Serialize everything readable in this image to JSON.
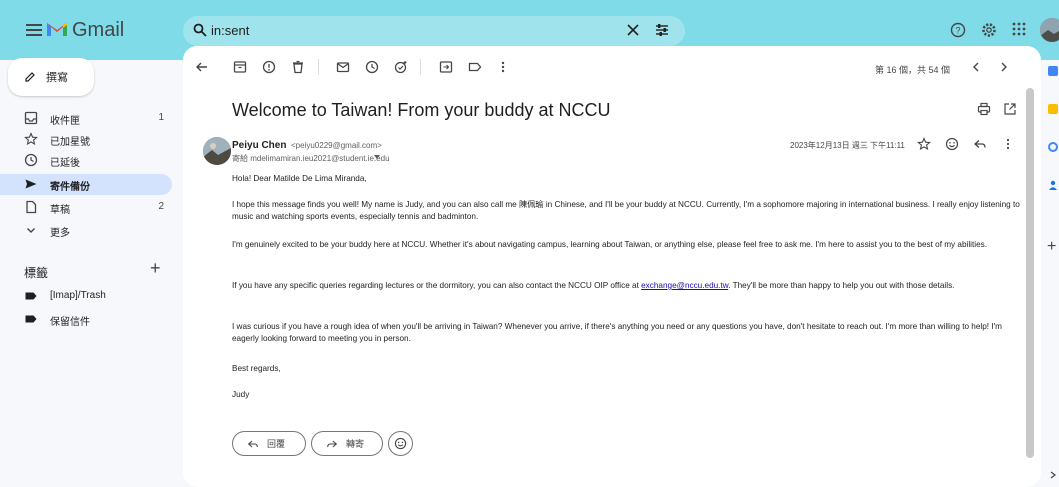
{
  "app": {
    "name": "Gmail",
    "brand_colors": {
      "topbar": "#7fdbe7",
      "active_nav": "#d3e3fd",
      "link": "#1a0dab"
    }
  },
  "search": {
    "value": "in:sent"
  },
  "sidebar": {
    "compose_label": "撰寫",
    "items": [
      {
        "label": "收件匣",
        "count": "1",
        "icon": "inbox-icon"
      },
      {
        "label": "已加星號",
        "count": "",
        "icon": "star-icon"
      },
      {
        "label": "已延後",
        "count": "",
        "icon": "clock-icon"
      },
      {
        "label": "寄件備份",
        "count": "",
        "icon": "send-icon",
        "active": true
      },
      {
        "label": "草稿",
        "count": "2",
        "icon": "draft-icon"
      },
      {
        "label": "更多",
        "count": "",
        "icon": "chevron-down-icon"
      }
    ],
    "labels_heading": "標籤",
    "labels": [
      {
        "label": "[Imap]/Trash",
        "icon": "label-icon"
      },
      {
        "label": "保留信件",
        "icon": "label-icon"
      }
    ]
  },
  "toolbar": {
    "page_info": "第 16 個，共 54 個"
  },
  "email": {
    "subject": "Welcome to Taiwan! From your buddy at NCCU",
    "sender_name": "Peiyu Chen",
    "sender_email": "<peiyu0229@gmail.com>",
    "recipient": "寄給 mdelimamiran.ieu2021@student.ie.edu",
    "date": "2023年12月13日 週三 下午11:11",
    "greeting": "Hola! Dear Matilde De Lima Miranda,",
    "p1": "I hope this message finds you well! My name is Judy, and you can also call me 陳佩瑜 in Chinese, and I'll be your buddy at NCCU. Currently, I'm a sophomore majoring in international business. I really enjoy listening to music and watching sports events, especially tennis and badminton.",
    "p2": "I'm genuinely excited to be your buddy here at NCCU. Whether it's about navigating campus, learning about Taiwan, or anything else, please feel free to ask me. I'm here to assist you to the best of my abilities.",
    "p3_before": "If you have any specific queries regarding lectures or the dormitory, you can also contact the NCCU OIP office at ",
    "p3_link": "exchange@nccu.edu.tw",
    "p3_after": ". They'll be more than happy to help you out with those details.",
    "p4": "I was curious if you have a rough idea of when you'll be arriving in Taiwan? Whenever you arrive, if there's anything you need or any questions you have, don't hesitate to reach out. I'm more than willing to help! I'm eagerly looking forward to meeting you in person.",
    "closing": "Best regards,",
    "signature": "Judy"
  },
  "actions": {
    "reply_label": "回覆",
    "forward_label": "轉寄"
  }
}
